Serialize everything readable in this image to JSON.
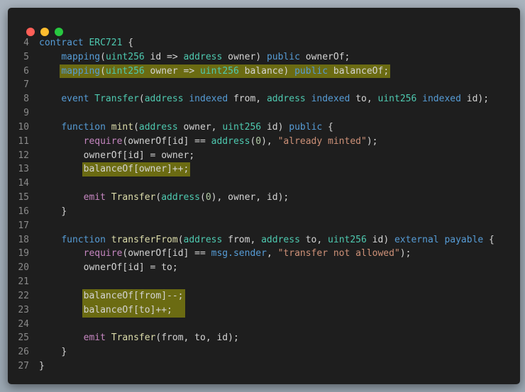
{
  "window": {
    "traffic_lights": [
      {
        "name": "close",
        "color": "#ff5f57"
      },
      {
        "name": "minimize",
        "color": "#febc2e"
      },
      {
        "name": "maximize",
        "color": "#28c840"
      }
    ]
  },
  "code": {
    "lines": [
      {
        "n": "4",
        "indent": 0,
        "tokens": [
          [
            "kw",
            "contract"
          ],
          [
            "plain",
            " "
          ],
          [
            "type",
            "ERC721"
          ],
          [
            "plain",
            " {"
          ]
        ]
      },
      {
        "n": "5",
        "indent": 1,
        "tokens": [
          [
            "kw",
            "mapping"
          ],
          [
            "plain",
            "("
          ],
          [
            "type",
            "uint256"
          ],
          [
            "plain",
            " id => "
          ],
          [
            "type",
            "address"
          ],
          [
            "plain",
            " owner) "
          ],
          [
            "kw",
            "public"
          ],
          [
            "plain",
            " ownerOf;"
          ]
        ]
      },
      {
        "n": "6",
        "indent": 1,
        "highlight": true,
        "tokens": [
          [
            "kw",
            "mapping"
          ],
          [
            "plain",
            "("
          ],
          [
            "type",
            "uint256"
          ],
          [
            "plain",
            " owner => "
          ],
          [
            "type",
            "uint256"
          ],
          [
            "plain",
            " balance) "
          ],
          [
            "kw",
            "public"
          ],
          [
            "plain",
            " balanceOf;"
          ]
        ]
      },
      {
        "n": "7",
        "indent": 0,
        "tokens": []
      },
      {
        "n": "8",
        "indent": 1,
        "tokens": [
          [
            "kw",
            "event"
          ],
          [
            "plain",
            " "
          ],
          [
            "type",
            "Transfer"
          ],
          [
            "plain",
            "("
          ],
          [
            "type",
            "address"
          ],
          [
            "plain",
            " "
          ],
          [
            "kw",
            "indexed"
          ],
          [
            "plain",
            " from, "
          ],
          [
            "type",
            "address"
          ],
          [
            "plain",
            " "
          ],
          [
            "kw",
            "indexed"
          ],
          [
            "plain",
            " to, "
          ],
          [
            "type",
            "uint256"
          ],
          [
            "plain",
            " "
          ],
          [
            "kw",
            "indexed"
          ],
          [
            "plain",
            " id);"
          ]
        ]
      },
      {
        "n": "9",
        "indent": 0,
        "tokens": []
      },
      {
        "n": "10",
        "indent": 1,
        "tokens": [
          [
            "kw",
            "function"
          ],
          [
            "plain",
            " "
          ],
          [
            "fn",
            "mint"
          ],
          [
            "plain",
            "("
          ],
          [
            "type",
            "address"
          ],
          [
            "plain",
            " owner, "
          ],
          [
            "type",
            "uint256"
          ],
          [
            "plain",
            " id) "
          ],
          [
            "kw",
            "public"
          ],
          [
            "plain",
            " {"
          ]
        ]
      },
      {
        "n": "11",
        "indent": 2,
        "tokens": [
          [
            "ctl",
            "require"
          ],
          [
            "plain",
            "(ownerOf[id] == "
          ],
          [
            "type",
            "address"
          ],
          [
            "plain",
            "("
          ],
          [
            "num",
            "0"
          ],
          [
            "plain",
            "), "
          ],
          [
            "str",
            "\"already minted\""
          ],
          [
            "plain",
            ");"
          ]
        ]
      },
      {
        "n": "12",
        "indent": 2,
        "tokens": [
          [
            "plain",
            "ownerOf[id] = owner;"
          ]
        ]
      },
      {
        "n": "13",
        "indent": 2,
        "highlight": true,
        "tokens": [
          [
            "plain",
            "balanceOf[owner]++;"
          ]
        ]
      },
      {
        "n": "14",
        "indent": 0,
        "tokens": []
      },
      {
        "n": "15",
        "indent": 2,
        "tokens": [
          [
            "ctl",
            "emit"
          ],
          [
            "plain",
            " "
          ],
          [
            "fn",
            "Transfer"
          ],
          [
            "plain",
            "("
          ],
          [
            "type",
            "address"
          ],
          [
            "plain",
            "("
          ],
          [
            "num",
            "0"
          ],
          [
            "plain",
            "), owner, id);"
          ]
        ]
      },
      {
        "n": "16",
        "indent": 1,
        "tokens": [
          [
            "plain",
            "}"
          ]
        ]
      },
      {
        "n": "17",
        "indent": 0,
        "tokens": []
      },
      {
        "n": "18",
        "indent": 1,
        "tokens": [
          [
            "kw",
            "function"
          ],
          [
            "plain",
            " "
          ],
          [
            "fn",
            "transferFrom"
          ],
          [
            "plain",
            "("
          ],
          [
            "type",
            "address"
          ],
          [
            "plain",
            " from, "
          ],
          [
            "type",
            "address"
          ],
          [
            "plain",
            " to, "
          ],
          [
            "type",
            "uint256"
          ],
          [
            "plain",
            " id) "
          ],
          [
            "kw",
            "external"
          ],
          [
            "plain",
            " "
          ],
          [
            "kw",
            "payable"
          ],
          [
            "plain",
            " {"
          ]
        ]
      },
      {
        "n": "19",
        "indent": 2,
        "tokens": [
          [
            "ctl",
            "require"
          ],
          [
            "plain",
            "(ownerOf[id] == "
          ],
          [
            "kw",
            "msg.sender"
          ],
          [
            "plain",
            ", "
          ],
          [
            "str",
            "\"transfer not allowed\""
          ],
          [
            "plain",
            ");"
          ]
        ]
      },
      {
        "n": "20",
        "indent": 2,
        "tokens": [
          [
            "plain",
            "ownerOf[id] = to;"
          ]
        ]
      },
      {
        "n": "21",
        "indent": 0,
        "tokens": []
      },
      {
        "n": "22",
        "indent": 2,
        "highlight": true,
        "group": "transfer",
        "tokens": [
          [
            "plain",
            "balanceOf[from]--;"
          ]
        ]
      },
      {
        "n": "23",
        "indent": 2,
        "highlight": true,
        "group": "transfer",
        "tokens": [
          [
            "plain",
            "balanceOf[to]++;"
          ]
        ]
      },
      {
        "n": "24",
        "indent": 0,
        "tokens": []
      },
      {
        "n": "25",
        "indent": 2,
        "tokens": [
          [
            "ctl",
            "emit"
          ],
          [
            "plain",
            " "
          ],
          [
            "fn",
            "Transfer"
          ],
          [
            "plain",
            "(from, to, id);"
          ]
        ]
      },
      {
        "n": "26",
        "indent": 1,
        "tokens": [
          [
            "plain",
            "}"
          ]
        ]
      },
      {
        "n": "27",
        "indent": 0,
        "tokens": [
          [
            "plain",
            "}"
          ]
        ]
      }
    ]
  }
}
